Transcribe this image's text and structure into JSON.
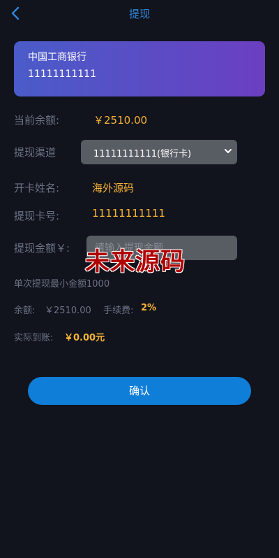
{
  "header": {
    "title": "提现",
    "back_icon": "chevron-left-icon"
  },
  "card": {
    "bank_name": "中国工商银行",
    "card_number": "11111111111",
    "gradient": [
      "#4a5cc9",
      "#6b3fc1"
    ]
  },
  "form": {
    "balance_label": "当前余额:",
    "balance_value": "￥2510.00",
    "channel_label": "提现渠道",
    "channel_selected": "11111111111(银行卡)",
    "name_label": "开卡姓名:",
    "name_value": "海外源码",
    "card_label": "提现卡号:",
    "card_value": "11111111111",
    "amount_label": "提现金额￥:",
    "amount_placeholder": "请输入提现金额",
    "min_note": "单次提现最小金额1000",
    "remain_label": "余额:",
    "remain_value": "￥2510.00",
    "fee_label": "手续费:",
    "fee_value": "2%",
    "actual_label": "实际到账:",
    "actual_value": "￥0.00元"
  },
  "watermark": "未来源码",
  "confirm_label": "确认",
  "colors": {
    "background": "#11131d",
    "accent": "#0f7ed8",
    "highlight": "#f6b335",
    "muted": "#6c7385"
  }
}
